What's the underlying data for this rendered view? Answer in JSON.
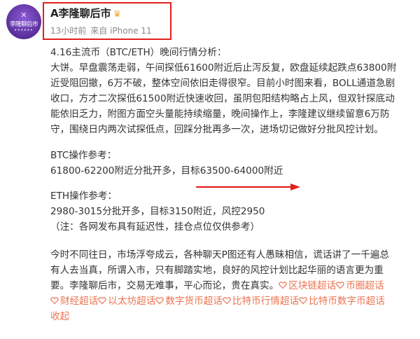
{
  "author": {
    "avatar_line1": "✕",
    "avatar_line2": "李隆聊后市",
    "avatar_line3": "••••••",
    "name": "A李隆聊后市",
    "badge": "crown-icon",
    "time": "13小时前",
    "source": "来自 iPhone 11"
  },
  "post": {
    "headline": "4.16主流币（BTC/ETH）晚间行情分析：",
    "analysis": [
      "大饼。早盘震荡走弱，午间探低61600附近后止泻反复，欧盘延续起跌点63800附",
      "近受阻回撤，6万不破，整体空间依旧走得很窄。目前小时图来看，BOLL通道急剧",
      "收口，方才二次探低61500附近快速收回，虽阴包阳结构略占上风，但双针探底动",
      "能依旧乏力，附图方面空头量能持续缩量，晚间操作上，李隆建议继续留意6万防",
      "守，围绕日内两次试探低点，回踩分批再多一次，进场切记做好分批风控计划。"
    ],
    "btc_title": "BTC操作参考：",
    "btc_plan": "61800-62200附近分批开多，目标63500-64000附近",
    "eth_title": "ETH操作参考：",
    "eth_plan": "2980-3015分批开多，目标3150附近，风控2950",
    "disclaimer": "（注：各网发布具有延迟性，挂仓点位仅供参考）",
    "closing": [
      "今时不同往日，市场浮夸成云，各种聊天P图还有人愚昧相信，谎话讲了一千遍总",
      "有人去当真，所谓入市，只有脚踏实地，良好的风控计划比起华丽的语言更为重",
      "要。李隆聊后市，交易无难事，平心而论，贵在真实。"
    ],
    "topics": [
      "区块链超话",
      "币圈超话",
      "财经超话",
      "以太坊超话",
      "数字货币超话",
      "比特币行情超话",
      "比特币数字币超话"
    ],
    "collapse_label": "收起"
  },
  "colors": {
    "highlight_box": "#e0211a",
    "topic": "#eb7350",
    "meta_text": "#8a8a8a"
  }
}
